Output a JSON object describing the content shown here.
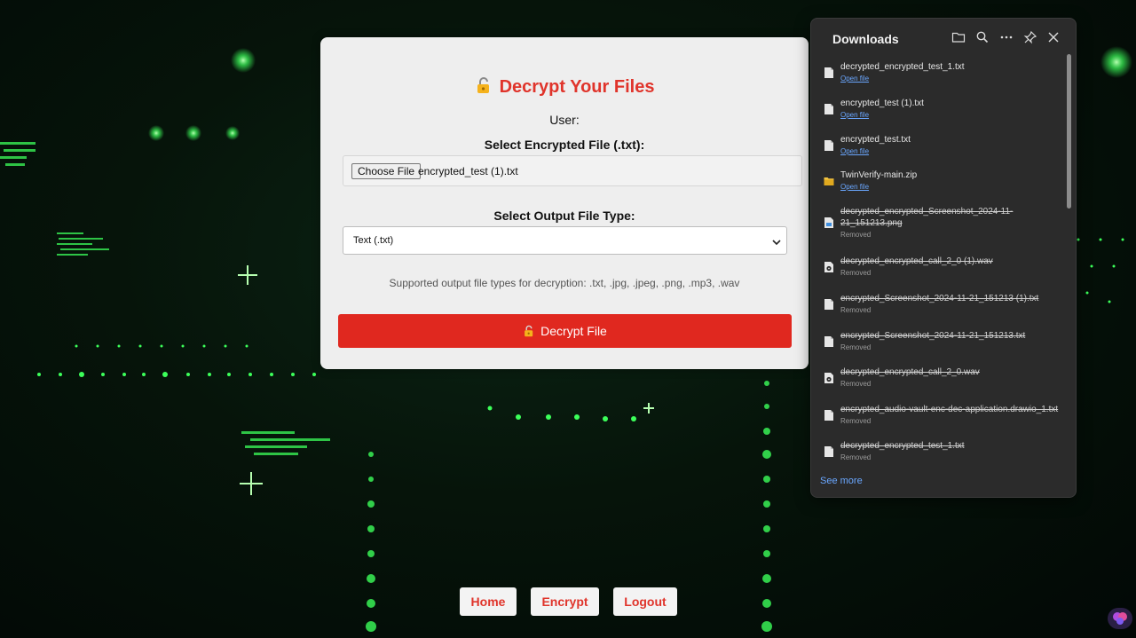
{
  "card": {
    "title": "Decrypt Your Files",
    "user_label": "User:",
    "file_label": "Select Encrypted File (.txt):",
    "choose_button": "Choose File",
    "file_name": "encrypted_test (1).txt",
    "output_label": "Select Output File Type:",
    "output_selected": "Text (.txt)",
    "supported_text": "Supported output file types for decryption: .txt, .jpg, .jpeg, .png, .mp3, .wav",
    "decrypt_button": "Decrypt File"
  },
  "nav": {
    "home": "Home",
    "encrypt": "Encrypt",
    "logout": "Logout"
  },
  "downloads": {
    "title": "Downloads",
    "items": [
      {
        "name": "decrypted_encrypted_test_1.txt",
        "sub": "Open file",
        "icon": "document-icon"
      },
      {
        "name": "encrypted_test (1).txt",
        "sub": "Open file",
        "icon": "document-icon"
      },
      {
        "name": "encrypted_test.txt",
        "sub": "Open file",
        "icon": "document-icon"
      },
      {
        "name": "TwinVerify-main.zip",
        "sub": "Open file",
        "icon": "folder-zip-icon"
      },
      {
        "name": "decrypted_encrypted_Screenshot_2024-11-21_151213.png",
        "sub": "Removed",
        "icon": "image-file-icon"
      },
      {
        "name": "decrypted_encrypted_call_2_0 (1).wav",
        "sub": "Removed",
        "icon": "audio-file-icon"
      },
      {
        "name": "encrypted_Screenshot_2024-11-21_151213 (1).txt",
        "sub": "Removed",
        "icon": "document-icon"
      },
      {
        "name": "encrypted_Screenshot_2024-11-21_151213.txt",
        "sub": "Removed",
        "icon": "document-icon"
      },
      {
        "name": "decrypted_encrypted_call_2_0.wav",
        "sub": "Removed",
        "icon": "audio-file-icon"
      },
      {
        "name": "encrypted_audio-vault-enc-dec-application.drawio_1.txt",
        "sub": "Removed",
        "icon": "document-icon"
      },
      {
        "name": "decrypted_encrypted_test_1.txt",
        "sub": "Removed",
        "icon": "document-icon"
      }
    ],
    "see_more": "See more"
  },
  "colors": {
    "accent_red": "#e0342b",
    "button_red": "#e0281f",
    "link_blue": "#6aa7ff",
    "matrix_green": "#3cff5a"
  }
}
